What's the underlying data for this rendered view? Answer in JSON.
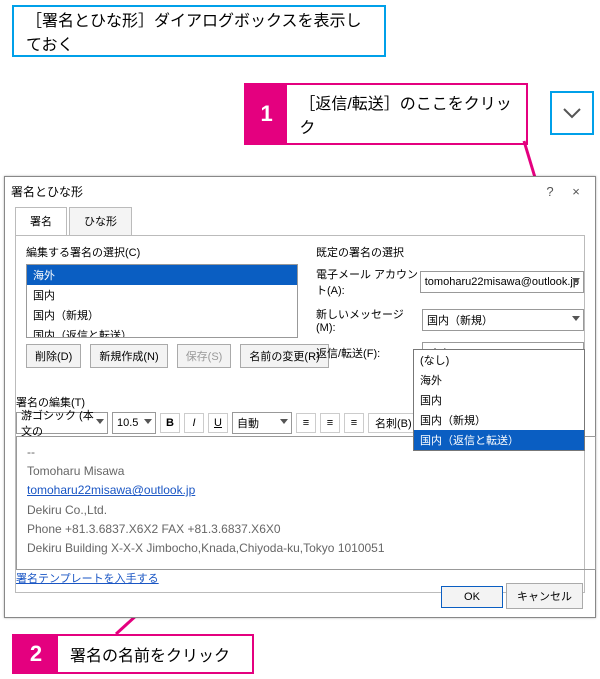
{
  "callouts": {
    "intro": "［署名とひな形］ダイアログボックスを表示しておく",
    "step1_num": "1",
    "step1": "［返信/転送］のここをクリック",
    "step2_num": "2",
    "step2": "署名の名前をクリック"
  },
  "dialog": {
    "title": "署名とひな形",
    "help": "?",
    "close": "×",
    "tabs": {
      "sig": "署名",
      "tmpl": "ひな形"
    },
    "select_label": "編集する署名の選択(C)",
    "signatures": [
      "海外",
      "国内",
      "国内（新規）",
      "国内（返信と転送）"
    ],
    "buttons": {
      "delete": "削除(D)",
      "new": "新規作成(N)",
      "save": "保存(S)",
      "rename": "名前の変更(R)"
    },
    "defaults": {
      "heading": "既定の署名の選択",
      "account_k": "電子メール アカウント(A):",
      "account_v": "tomoharu22misawa@outlook.jp",
      "newmsg_k": "新しいメッセージ(M):",
      "newmsg_v": "国内（新規）",
      "reply_k": "返信/転送(F):",
      "reply_v": "(なし)"
    },
    "dropdown": [
      "(なし)",
      "海外",
      "国内",
      "国内（新規）",
      "国内（返信と転送）"
    ],
    "edit_label": "署名の編集(T)",
    "toolbar": {
      "font": "游ゴシック (本文の",
      "size": "10.5",
      "auto": "自動",
      "card": "名刺(B)"
    },
    "content": [
      "--",
      "Tomoharu Misawa",
      "tomoharu22misawa@outlook.jp",
      "Dekiru Co.,Ltd.",
      "Phone +81.3.6837.X6X2 FAX +81.3.6837.X6X0",
      "Dekiru Building X-X-X Jimbocho,Knada,Chiyoda-ku,Tokyo 1010051"
    ],
    "template_link": "署名テンプレートを入手する",
    "ok": "OK",
    "cancel": "キャンセル"
  }
}
